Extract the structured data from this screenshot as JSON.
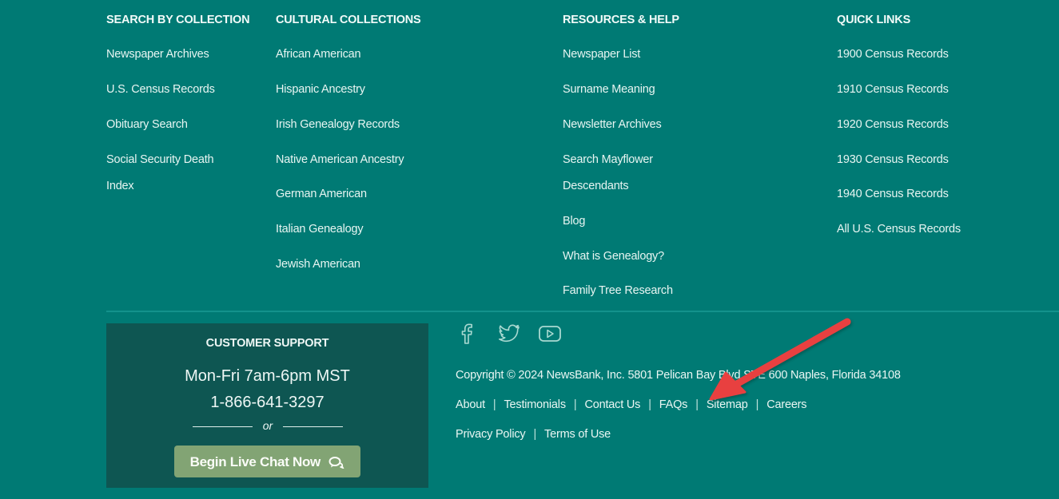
{
  "columns": [
    {
      "heading": "SEARCH BY COLLECTION",
      "links": [
        "Newspaper Archives",
        "U.S. Census Records",
        "Obituary Search",
        "Social Security Death",
        "Index"
      ]
    },
    {
      "heading": "CULTURAL COLLECTIONS",
      "links": [
        "African American",
        "Hispanic Ancestry",
        "Irish Genealogy Records",
        "Native American Ancestry",
        "German American",
        "Italian Genealogy",
        "Jewish American"
      ]
    },
    {
      "heading": "RESOURCES & HELP",
      "links": [
        "Newspaper List",
        "Surname Meaning",
        "Newsletter Archives",
        "Search Mayflower",
        "Descendants",
        "Blog",
        "What is Genealogy?",
        "Family Tree Research"
      ]
    },
    {
      "heading": "QUICK LINKS",
      "links": [
        "1900 Census Records",
        "1910 Census Records",
        "1920 Census Records",
        "1930 Census Records",
        "1940 Census Records",
        "All U.S. Census Records"
      ]
    }
  ],
  "support": {
    "title": "CUSTOMER SUPPORT",
    "hours": "Mon-Fri 7am-6pm MST",
    "phone": "1-866-641-3297",
    "or": "or",
    "chat_button": "Begin Live Chat Now",
    "chat_icon": "chat-bubbles-icon"
  },
  "social": [
    "facebook-icon",
    "twitter-icon",
    "youtube-icon"
  ],
  "copyright": "Copyright © 2024 NewsBank, Inc. 5801 Pelican Bay Blvd STE 600 Naples, Florida 34108",
  "footer_links_row1": [
    "About",
    "Testimonials",
    "Contact Us",
    "FAQs",
    "Sitemap",
    "Careers"
  ],
  "footer_links_row2": [
    "Privacy Policy",
    "Terms of Use"
  ],
  "annotation": {
    "type": "red-arrow",
    "points_to": "FAQs",
    "color": "#e8403f"
  },
  "colors": {
    "background": "#007a74",
    "support_panel": "#0e5652",
    "chat_button": "#82a474",
    "divider": "#13928c"
  }
}
